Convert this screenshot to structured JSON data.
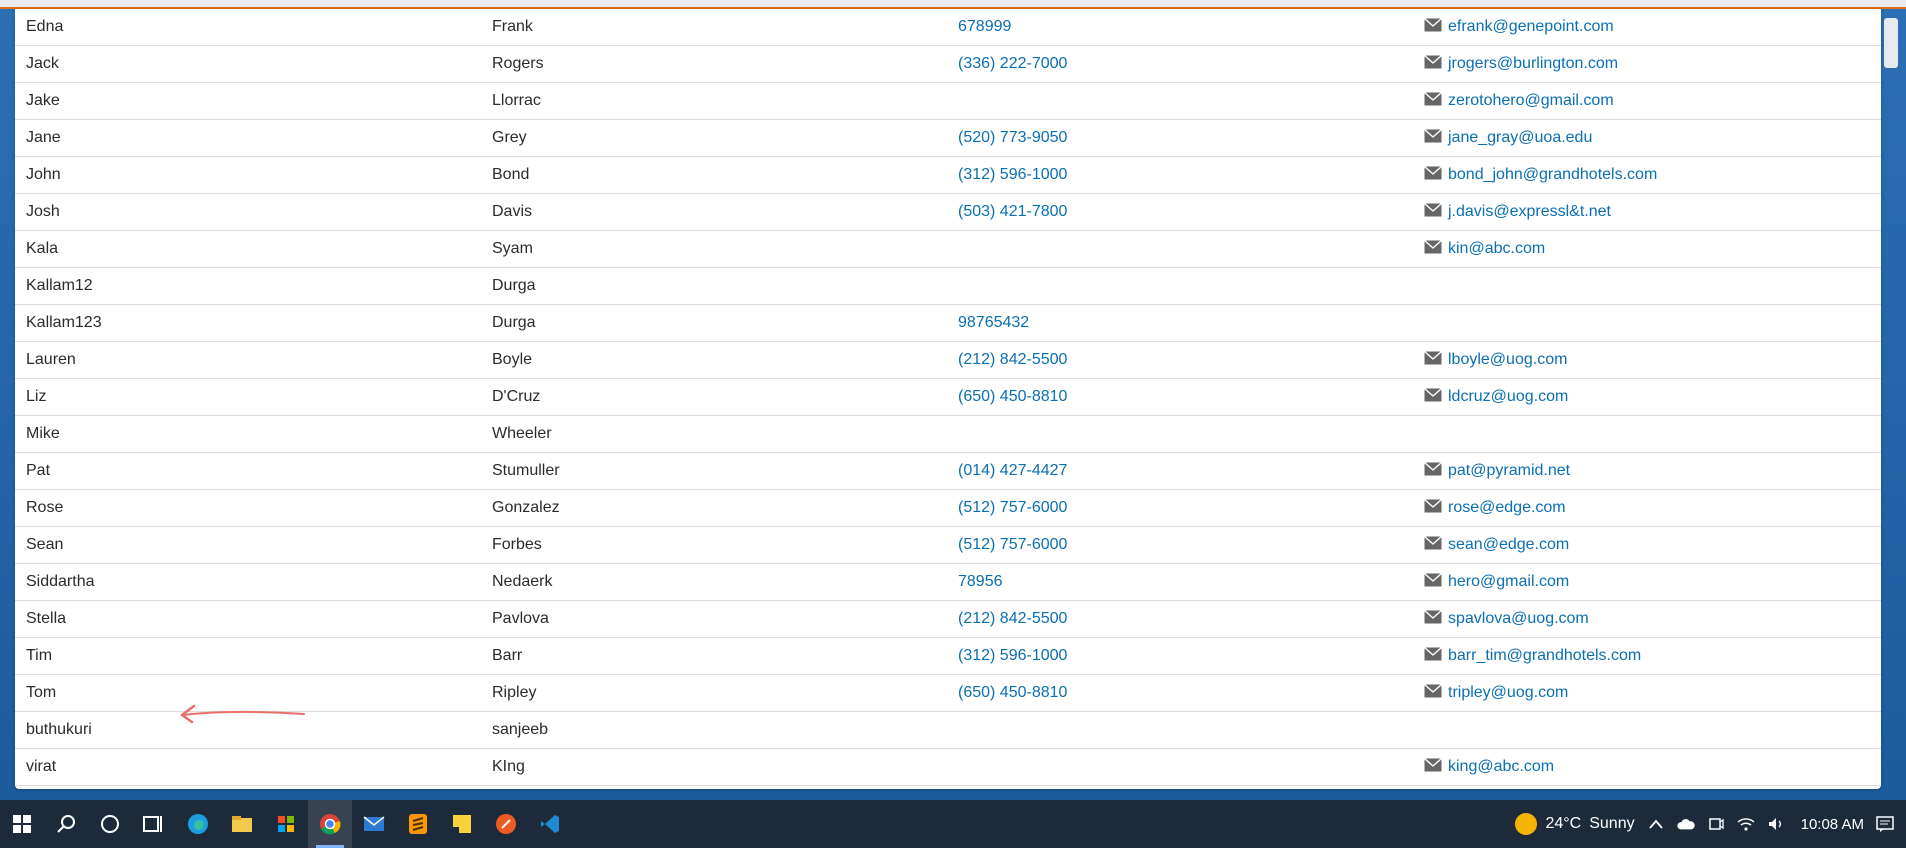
{
  "contacts": [
    {
      "first": "Edna",
      "last": "Frank",
      "phone": "678999",
      "email": "efrank@genepoint.com"
    },
    {
      "first": "Jack",
      "last": "Rogers",
      "phone": "(336) 222-7000",
      "email": "jrogers@burlington.com"
    },
    {
      "first": "Jake",
      "last": "Llorrac",
      "phone": "",
      "email": "zerotohero@gmail.com"
    },
    {
      "first": "Jane",
      "last": "Grey",
      "phone": "(520) 773-9050",
      "email": "jane_gray@uoa.edu"
    },
    {
      "first": "John",
      "last": "Bond",
      "phone": "(312) 596-1000",
      "email": "bond_john@grandhotels.com"
    },
    {
      "first": "Josh",
      "last": "Davis",
      "phone": "(503) 421-7800",
      "email": "j.davis@expressl&t.net"
    },
    {
      "first": "Kala",
      "last": "Syam",
      "phone": "",
      "email": "kin@abc.com"
    },
    {
      "first": "Kallam12",
      "last": "Durga",
      "phone": "",
      "email": ""
    },
    {
      "first": "Kallam123",
      "last": "Durga",
      "phone": "98765432",
      "email": ""
    },
    {
      "first": "Lauren",
      "last": "Boyle",
      "phone": "(212) 842-5500",
      "email": "lboyle@uog.com"
    },
    {
      "first": "Liz",
      "last": "D'Cruz",
      "phone": "(650) 450-8810",
      "email": "ldcruz@uog.com"
    },
    {
      "first": "Mike",
      "last": "Wheeler",
      "phone": "",
      "email": ""
    },
    {
      "first": "Pat",
      "last": "Stumuller",
      "phone": "(014) 427-4427",
      "email": "pat@pyramid.net"
    },
    {
      "first": "Rose",
      "last": "Gonzalez",
      "phone": "(512) 757-6000",
      "email": "rose@edge.com"
    },
    {
      "first": "Sean",
      "last": "Forbes",
      "phone": "(512) 757-6000",
      "email": "sean@edge.com"
    },
    {
      "first": "Siddartha",
      "last": "Nedaerk",
      "phone": "78956",
      "email": "hero@gmail.com"
    },
    {
      "first": "Stella",
      "last": "Pavlova",
      "phone": "(212) 842-5500",
      "email": "spavlova@uog.com"
    },
    {
      "first": "Tim",
      "last": "Barr",
      "phone": "(312) 596-1000",
      "email": "barr_tim@grandhotels.com"
    },
    {
      "first": "Tom",
      "last": "Ripley",
      "phone": "(650) 450-8810",
      "email": "tripley@uog.com"
    },
    {
      "first": "buthukuri",
      "last": "sanjeeb",
      "phone": "",
      "email": ""
    },
    {
      "first": "virat",
      "last": "KIng",
      "phone": "",
      "email": "king@abc.com"
    }
  ],
  "taskbar": {
    "apps": [
      "windows-start",
      "search",
      "cortana",
      "task-view",
      "edge",
      "file-explorer",
      "microsoft-store",
      "chrome",
      "mail",
      "sublime-text",
      "sticky-notes",
      "postman",
      "vscode"
    ],
    "active_app": "chrome",
    "weather_temp": "24°C",
    "weather_text": "Sunny",
    "time": "10:08 AM"
  },
  "colors": {
    "accent": "#e06a1f",
    "link": "#0b6fb3",
    "taskbar": "#1d2a3a"
  }
}
